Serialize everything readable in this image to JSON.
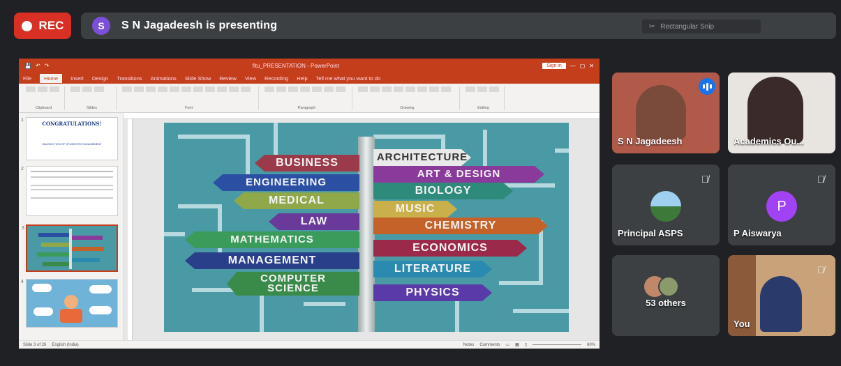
{
  "recording": {
    "label": "REC"
  },
  "presenter": {
    "initial": "S",
    "text": "S N Jagadeesh is presenting"
  },
  "pin_hint": "Rectangular Snip",
  "powerpoint": {
    "title": "fitu_PRESENTATION - PowerPoint",
    "sign_in": "Sign in",
    "tabs": [
      "File",
      "Home",
      "Insert",
      "Design",
      "Transitions",
      "Animations",
      "Slide Show",
      "Review",
      "View",
      "Recording",
      "Help",
      "Tell me what you want to do"
    ],
    "ribbon_groups": [
      "Clipboard",
      "Slides",
      "Font",
      "Paragraph",
      "Drawing",
      "Editing"
    ],
    "status_left": "Slide 3 of 26",
    "status_lang": "English (India)",
    "status_notes": "Notes",
    "status_comments": "Comments",
    "zoom": "60%"
  },
  "thumbnails": [
    {
      "num": "1",
      "title": "CONGRATULATIONS!",
      "sub": "VALEDICTION OF STUDENTS ENGAGEMENT"
    },
    {
      "num": "2",
      "title": "",
      "sub": ""
    },
    {
      "num": "3",
      "title": "",
      "sub": ""
    },
    {
      "num": "4",
      "title": "",
      "sub": ""
    }
  ],
  "slide_signs": [
    {
      "label": "BUSINESS",
      "color": "#9b3a4a",
      "dir": "left"
    },
    {
      "label": "ARCHITECTURE",
      "color": "#e9e9e9",
      "dir": "right",
      "text": "#333"
    },
    {
      "label": "ENGINEERING",
      "color": "#2a4fa3",
      "dir": "left"
    },
    {
      "label": "ART & DESIGN",
      "color": "#8a3a9b",
      "dir": "right"
    },
    {
      "label": "BIOLOGY",
      "color": "#2e8a7a",
      "dir": "right"
    },
    {
      "label": "MEDICAL",
      "color": "#8fa84a",
      "dir": "left"
    },
    {
      "label": "MUSIC",
      "color": "#c9b04a",
      "dir": "right"
    },
    {
      "label": "LAW",
      "color": "#6a3a9b",
      "dir": "left"
    },
    {
      "label": "CHEMISTRY",
      "color": "#c4622a",
      "dir": "right"
    },
    {
      "label": "MATHEMATICS",
      "color": "#3a9b5a",
      "dir": "left"
    },
    {
      "label": "ECONOMICS",
      "color": "#9b2a4a",
      "dir": "right"
    },
    {
      "label": "MANAGEMENT",
      "color": "#2a3f8a",
      "dir": "left"
    },
    {
      "label": "LITERATURE",
      "color": "#2a8ab0",
      "dir": "right"
    },
    {
      "label": "COMPUTER SCIENCE",
      "color": "#3a8a4a",
      "dir": "left"
    },
    {
      "label": "PHYSICS",
      "color": "#5a3aa8",
      "dir": "right"
    }
  ],
  "participants": [
    {
      "name": "S N Jagadeesh",
      "speaking": true
    },
    {
      "name": "Academics Ou...",
      "muted": true
    },
    {
      "name": "Principal ASPS",
      "muted": true
    },
    {
      "name": "P Aiswarya",
      "initial": "P",
      "muted": true
    },
    {
      "name": "53 others"
    },
    {
      "name": "You",
      "muted": true
    }
  ],
  "colors": {
    "rec": "#d93025",
    "ppt": "#c43e1c",
    "avatar_p": "#a142f4",
    "presenter_avatar": "#7b4fd8"
  }
}
